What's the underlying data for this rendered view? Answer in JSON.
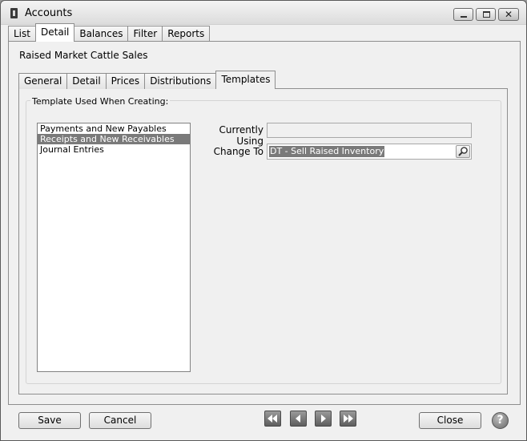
{
  "window": {
    "title": "Accounts",
    "icon": "ledger-icon",
    "controls": [
      "minimize-icon",
      "maximize-icon",
      "close-icon"
    ]
  },
  "main_tabs": [
    {
      "label": "List",
      "active": false
    },
    {
      "label": "Detail",
      "active": true
    },
    {
      "label": "Balances",
      "active": false
    },
    {
      "label": "Filter",
      "active": false
    },
    {
      "label": "Reports",
      "active": false
    }
  ],
  "record_name": "Raised Market Cattle Sales",
  "sub_tabs": [
    {
      "label": "General",
      "active": false
    },
    {
      "label": "Detail",
      "active": false
    },
    {
      "label": "Prices",
      "active": false
    },
    {
      "label": "Distributions",
      "active": false
    },
    {
      "label": "Templates",
      "active": true
    }
  ],
  "templates": {
    "group_label": "Template Used When Creating:",
    "list_items": [
      {
        "label": "Payments and New Payables",
        "selected": false
      },
      {
        "label": "Receipts and New Receivables",
        "selected": true
      },
      {
        "label": "Journal Entries",
        "selected": false
      }
    ],
    "currently_using_label": "Currently Using",
    "currently_using_value": "",
    "change_to_label": "Change To",
    "change_to_value": "DT - Sell Raised Inventory",
    "lookup_icon": "magnifier-icon"
  },
  "footer": {
    "save_label": "Save",
    "cancel_label": "Cancel",
    "close_label": "Close",
    "nav_icons": [
      "first-record-icon",
      "previous-record-icon",
      "next-record-icon",
      "last-record-icon"
    ],
    "help_icon": "help-icon"
  },
  "colors": {
    "selection": "#7a7a7a",
    "window_bg": "#f0f0f0",
    "nav_button": "#6e6e6e"
  }
}
